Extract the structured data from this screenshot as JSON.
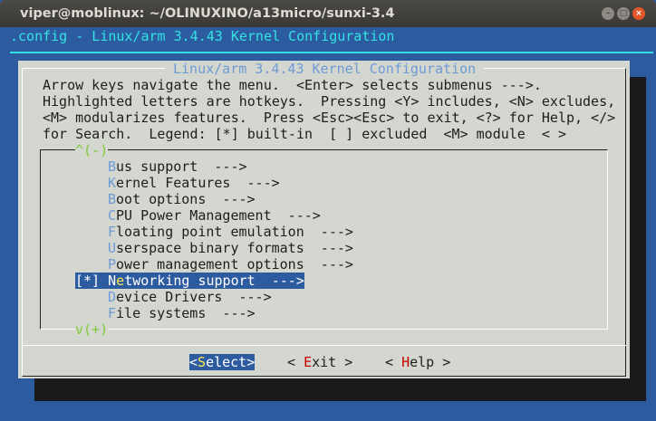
{
  "window": {
    "title": "viper@moblinux: ~/OLINUXINO/a13micro/sunxi-3.4"
  },
  "header": {
    "title": ".config - Linux/arm 3.4.43 Kernel Configuration"
  },
  "dialog": {
    "title": "Linux/arm 3.4.43 Kernel Configuration",
    "help_lines": [
      "Arrow keys navigate the menu.  <Enter> selects submenus --->.",
      "Highlighted letters are hotkeys.  Pressing <Y> includes, <N> excludes,",
      "<M> modularizes features.  Press <Esc><Esc> to exit, <?> for Help, </>",
      "for Search.  Legend: [*] built-in  [ ] excluded  <M> module  < >"
    ],
    "scroll_up": "^(-)",
    "scroll_down": "v(+)",
    "items": [
      {
        "prefix": "",
        "hotkey": "B",
        "rest": "us support  --->",
        "hk_index": 0
      },
      {
        "prefix": "",
        "hotkey": "K",
        "rest": "ernel Features  --->",
        "hk_index": 0
      },
      {
        "prefix": "",
        "hotkey": "B",
        "rest": "oot options  --->",
        "hk_index": 0
      },
      {
        "prefix": "",
        "hotkey": "C",
        "rest": "PU Power Management  --->",
        "hk_index": 0
      },
      {
        "prefix": "",
        "hotkey": "F",
        "rest": "loating point emulation  --->",
        "hk_index": 0
      },
      {
        "prefix": "",
        "hotkey": "U",
        "rest": "serspace binary formats  --->",
        "hk_index": 0
      },
      {
        "prefix": "",
        "hotkey": "P",
        "rest": "ower management options  --->",
        "hk_index": 0
      },
      {
        "prefix": "[*] ",
        "hotkey": "Networking support  --->",
        "rest": "",
        "hk_index": 1,
        "selected": true
      },
      {
        "prefix": "",
        "hotkey": "D",
        "rest": "evice Drivers  --->",
        "hk_index": 0
      },
      {
        "prefix": "",
        "hotkey": "F",
        "rest": "ile systems  --->",
        "hk_index": 0
      }
    ],
    "buttons": {
      "select": {
        "open": "<",
        "hotkey": "S",
        "rest": "elect>"
      },
      "exit": {
        "open": "< ",
        "hotkey": "E",
        "rest": "xit >"
      },
      "help": {
        "open": "< ",
        "hotkey": "H",
        "rest": "elp >"
      }
    }
  }
}
